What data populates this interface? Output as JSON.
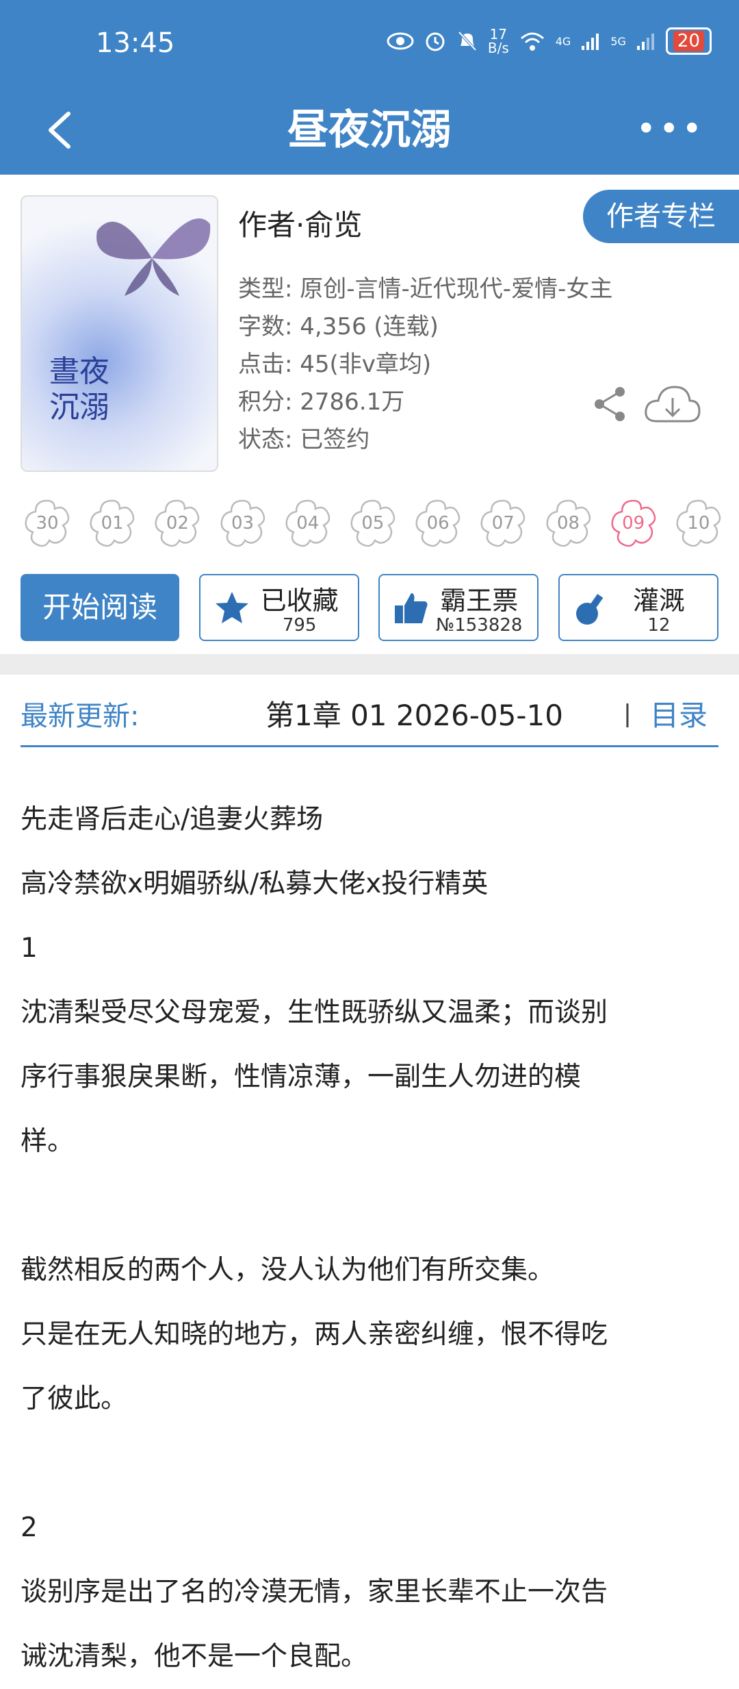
{
  "status_bar": {
    "time": "13:45",
    "net_speed_top": "17",
    "net_speed_unit": "B/s",
    "sig1": "4G",
    "sig2": "5G",
    "battery": "20"
  },
  "nav": {
    "title": "昼夜沉溺"
  },
  "book": {
    "cover_title": "晝夜沉溺",
    "author": "作者·俞览",
    "author_button": "作者专栏",
    "meta": [
      "类型: 原创-言情-近代现代-爱情-女主",
      "字数: 4,356 (连载)",
      "点击: 45(非v章均)",
      "积分: 2786.1万",
      "状态: 已签约"
    ]
  },
  "flowers": [
    "30",
    "01",
    "02",
    "03",
    "04",
    "05",
    "06",
    "07",
    "08",
    "09",
    "10"
  ],
  "actions": {
    "start": "开始阅读",
    "collect_label": "已收藏",
    "collect_count": "795",
    "vote_label": "霸王票",
    "vote_count": "№153828",
    "irrigate_label": "灌溉",
    "irrigate_count": "12"
  },
  "update": {
    "label": "最新更新:",
    "chapter": "第1章  01  2026-05-10",
    "separator": "丨",
    "toc": "目录"
  },
  "description": [
    "先走肾后走心/追妻火葬场",
    "高冷禁欲x明媚骄纵/私募大佬x投行精英",
    "1",
    "沈清梨受尽父母宠爱，生性既骄纵又温柔；而谈别",
    "序行事狠戾果断，性情凉薄，一副生人勿进的模",
    "样。",
    "",
    "截然相反的两个人，没人认为他们有所交集。",
    "只是在无人知晓的地方，两人亲密纠缠，恨不得吃",
    "了彼此。",
    "",
    "2",
    "谈别序是出了名的冷漠无情，家里长辈不止一次告",
    "诫沈清梨，他不是一个良配。"
  ],
  "colors": {
    "primary": "#3f84c6",
    "active_flower": "#ec6b8c",
    "gap": "#ececec"
  }
}
